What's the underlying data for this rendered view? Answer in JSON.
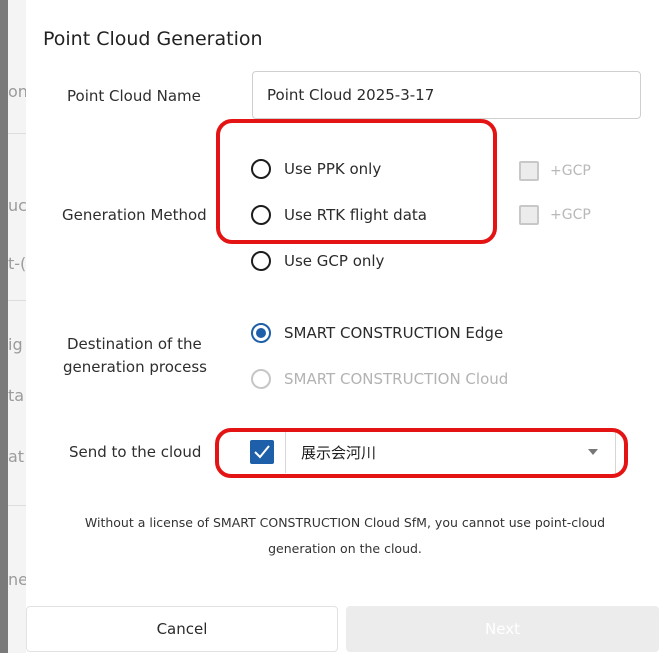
{
  "background": {
    "fragments": [
      "on",
      "uc",
      "t-(",
      "ig",
      "ta",
      "at",
      "ne"
    ]
  },
  "dialog": {
    "title": "Point Cloud Generation",
    "name_label": "Point Cloud Name",
    "name_value": "Point Cloud 2025-3-17",
    "method_label": "Generation Method",
    "methods": [
      {
        "label": "Use PPK only",
        "selected": false,
        "gcp_label": "+GCP"
      },
      {
        "label": "Use RTK flight data",
        "selected": false,
        "gcp_label": "+GCP"
      },
      {
        "label": "Use GCP only",
        "selected": false
      }
    ],
    "destination_label_line1": "Destination of the",
    "destination_label_line2": "generation process",
    "destinations": [
      {
        "label": "SMART CONSTRUCTION Edge",
        "selected": true,
        "disabled": false
      },
      {
        "label": "SMART CONSTRUCTION Cloud",
        "selected": false,
        "disabled": true
      }
    ],
    "send_label": "Send to the cloud",
    "send_checked": true,
    "send_select_value": "展示会河川",
    "notice_line1": "Without a license of SMART CONSTRUCTION Cloud SfM, you cannot use point-cloud",
    "notice_line2": "generation on the cloud.",
    "cancel_label": "Cancel",
    "next_label": "Next"
  },
  "colors": {
    "accent": "#1d5fa8",
    "highlight": "#e41414",
    "disabled": "#b3b3b3"
  }
}
